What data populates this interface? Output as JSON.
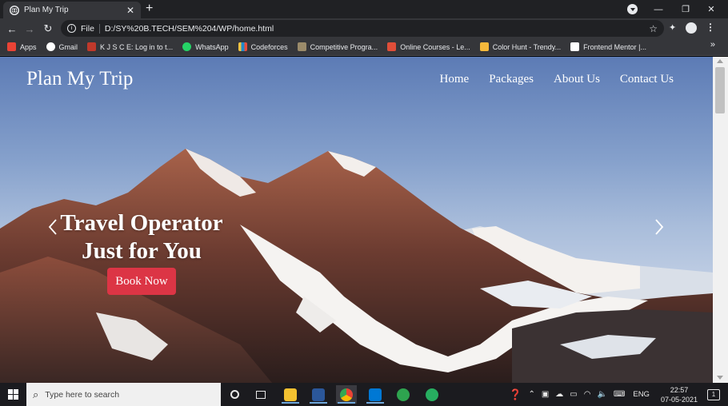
{
  "browser": {
    "tab_title": "Plan My Trip",
    "tab_close": "✕",
    "new_tab": "+",
    "scheme_label": "File",
    "url": "D:/SY%20B.TECH/SEM%204/WP/home.html",
    "bookmarks": [
      {
        "label": "Apps",
        "color": "#ea4335"
      },
      {
        "label": "Gmail",
        "color": "#ffffff"
      },
      {
        "label": "K J S C E: Log in to t...",
        "color": "#c0392b"
      },
      {
        "label": "WhatsApp",
        "color": "#25d366"
      },
      {
        "label": "Codeforces",
        "color": "#1f8acb"
      },
      {
        "label": "Competitive Progra...",
        "color": "#9b8b6a"
      },
      {
        "label": "Online Courses - Le...",
        "color": "#e04e39"
      },
      {
        "label": "Color Hunt - Trendy...",
        "color": "#f6b93b"
      },
      {
        "label": "Frontend Mentor |...",
        "color": "#ffffff"
      }
    ],
    "bookmarks_more": "»"
  },
  "site": {
    "brand": "Plan My Trip",
    "nav": [
      "Home",
      "Packages",
      "About Us",
      "Contact Us"
    ],
    "hero_line1": "Travel Operator",
    "hero_line2": "Just for You",
    "cta": "Book Now"
  },
  "taskbar": {
    "search_placeholder": "Type here to search",
    "lang": "ENG",
    "time": "22:57",
    "date": "07-05-2021",
    "notification_count": "1"
  },
  "colors": {
    "cta": "#dc3545",
    "chrome_dark": "#202124",
    "chrome_toolbar": "#35363a"
  }
}
